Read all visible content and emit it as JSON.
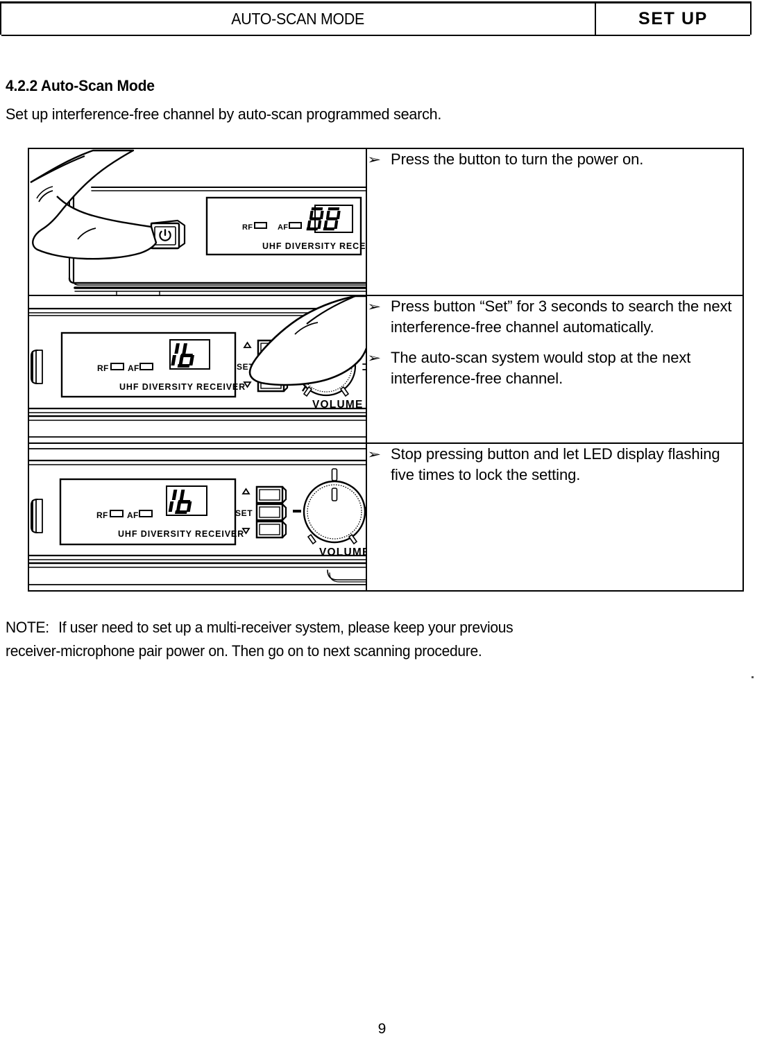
{
  "header": {
    "running_title": "AUTO-SCAN MODE",
    "section_tag": "SET UP"
  },
  "section": {
    "heading": "4.2.2 Auto-Scan Mode",
    "intro": "Set up interference-free channel by auto-scan programmed search."
  },
  "steps": [
    {
      "figure": {
        "name": "receiver-power-button-press",
        "display_value": "88",
        "indicators": [
          "RF",
          "AF"
        ],
        "panel_label": "UHF DIVERSITY RECEIVER",
        "has_hand": true,
        "hand_target": "power-button"
      },
      "bullets": [
        "Press the button to turn the power on."
      ]
    },
    {
      "figure": {
        "name": "receiver-set-button-press",
        "display_value": "16",
        "indicators": [
          "RF",
          "AF"
        ],
        "panel_label": "UHF DIVERSITY RECEIVER",
        "buttons": [
          "△",
          "SET",
          "▽"
        ],
        "knob_label": "VOLUME",
        "has_hand": true,
        "hand_target": "set-button"
      },
      "bullets": [
        "Press button “Set” for 3 seconds to search the next interference-free channel automatically.",
        "The auto-scan system would stop at the next interference-free channel."
      ]
    },
    {
      "figure": {
        "name": "receiver-locked-setting",
        "display_value": "16",
        "indicators": [
          "RF",
          "AF"
        ],
        "panel_label": "UHF DIVERSITY RECEIVER",
        "buttons": [
          "△",
          "SET",
          "▽"
        ],
        "knob_label": "VOLUME",
        "has_hand": false
      },
      "bullets": [
        "Stop pressing button and let LED display flashing five times to lock the setting."
      ]
    }
  ],
  "bullet_glyph": "➢",
  "note": {
    "label": "NOTE:",
    "line1": "If user need to set up a multi-receiver system, please keep your previous",
    "line2": "receiver-microphone pair power on. Then go on to next scanning procedure."
  },
  "footer": {
    "page_number": "9"
  },
  "colors": {
    "ink": "#000000",
    "paper": "#ffffff"
  }
}
